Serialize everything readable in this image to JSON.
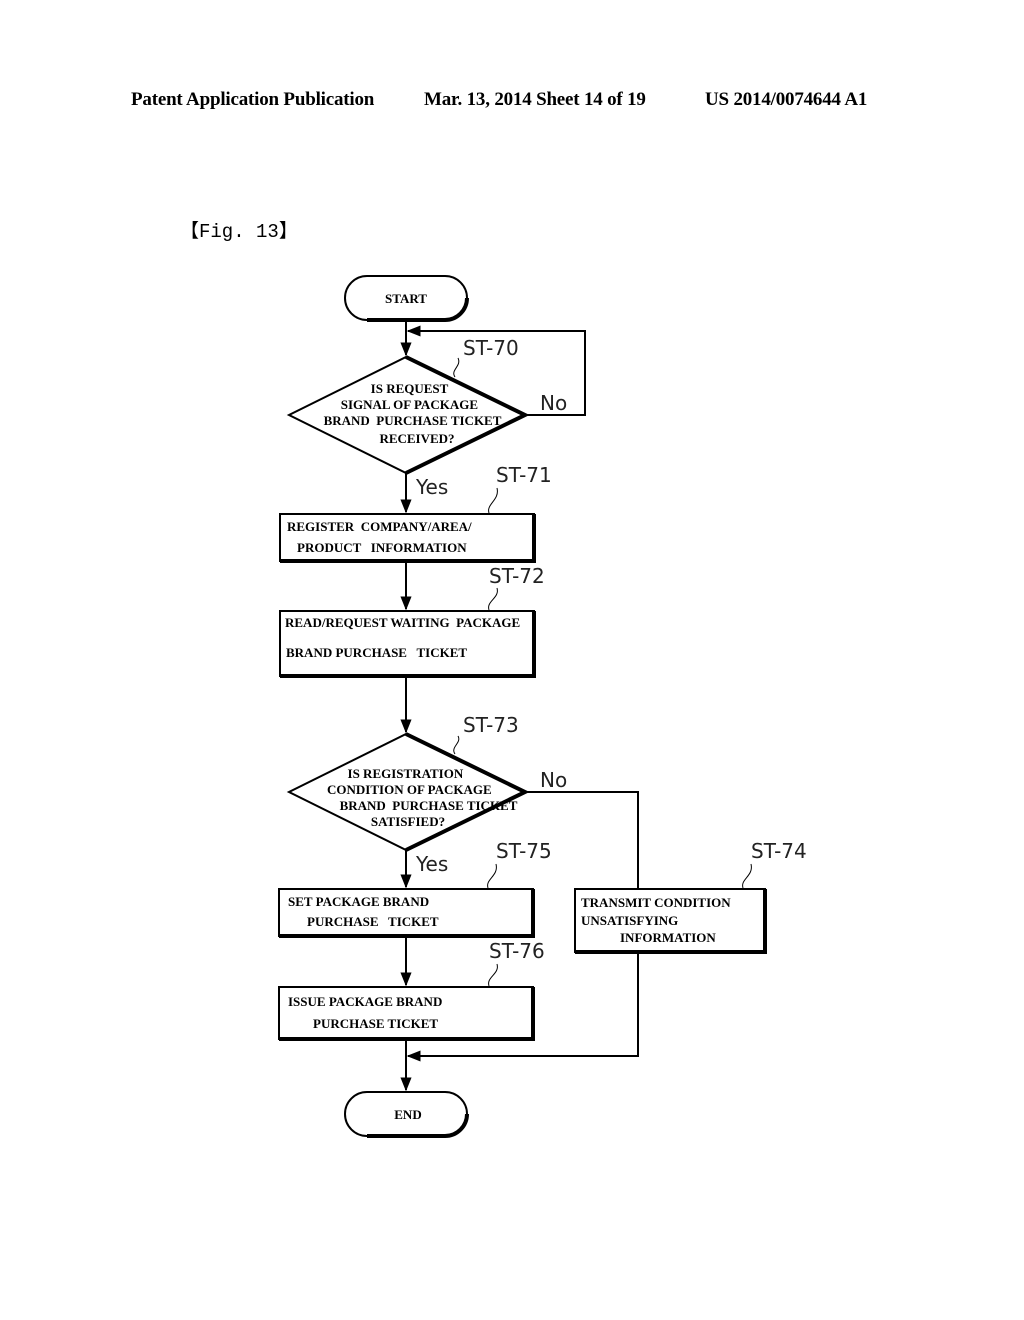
{
  "header": {
    "publication": "Patent Application Publication",
    "date_sheet": "Mar. 13, 2014  Sheet 14 of 19",
    "patent_number": "US 2014/0074644 A1"
  },
  "figure": {
    "label": "【Fig. 13】",
    "start": "START",
    "end": "END",
    "steps": {
      "st70": {
        "ref": "ST-70",
        "type": "decision",
        "lines": [
          "IS REQUEST",
          "SIGNAL OF PACKAGE",
          "BRAND  PURCHASE TICKET",
          "RECEIVED?"
        ],
        "no_label": "No",
        "yes_label": "Yes"
      },
      "st71": {
        "ref": "ST-71",
        "type": "process",
        "lines": [
          "REGISTER  COMPANY/AREA/",
          "PRODUCT   INFORMATION"
        ]
      },
      "st72": {
        "ref": "ST-72",
        "type": "process",
        "lines": [
          "READ/REQUEST WAITING  PACKAGE",
          "BRAND PURCHASE   TICKET"
        ]
      },
      "st73": {
        "ref": "ST-73",
        "type": "decision",
        "lines": [
          "IS REGISTRATION",
          "CONDITION OF PACKAGE",
          "BRAND  PURCHASE TICKET",
          "SATISFIED?"
        ],
        "no_label": "No",
        "yes_label": "Yes"
      },
      "st74": {
        "ref": "ST-74",
        "type": "process",
        "lines": [
          "TRANSMIT CONDITION",
          "UNSATISFYING",
          "INFORMATION"
        ]
      },
      "st75": {
        "ref": "ST-75",
        "type": "process",
        "lines": [
          "SET PACKAGE BRAND",
          "PURCHASE   TICKET"
        ]
      },
      "st76": {
        "ref": "ST-76",
        "type": "process",
        "lines": [
          "ISSUE PACKAGE BRAND",
          "PURCHASE TICKET"
        ]
      }
    }
  }
}
